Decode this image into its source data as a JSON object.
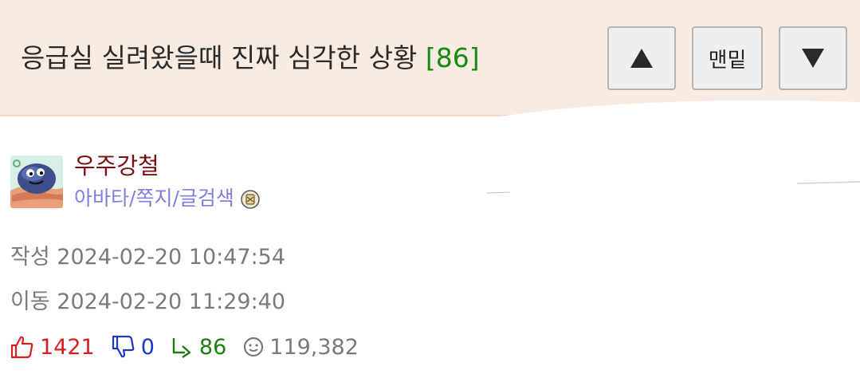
{
  "header": {
    "title": "응급실 실려왔을때 진짜 심각한 상황",
    "reply_count": "[86]",
    "background": "#f8ebe2",
    "buttons": {
      "up_icon": "triangle-up-icon",
      "bottom_label": "맨밑",
      "down_icon": "triangle-down-icon"
    }
  },
  "author": {
    "name": "우주강철",
    "name_color": "#7a1010",
    "avatar_icon": "rock-character-avatar",
    "links": [
      "아바타",
      "쪽지",
      "글검색"
    ],
    "separator": "/",
    "badge_icon": "scroll-badge-icon",
    "link_color": "#7f7fe0"
  },
  "meta": {
    "created_label": "작성",
    "created_time": "2024-02-20 10:47:54",
    "moved_label": "이동",
    "moved_time": "2024-02-20 11:29:40"
  },
  "stats": {
    "likes": "1421",
    "dislikes": "0",
    "replies": "86",
    "views": "119,382",
    "like_color": "#d42020",
    "dislike_color": "#1d36c7",
    "reply_color": "#1d7d12",
    "view_color": "#7a7a7a"
  }
}
